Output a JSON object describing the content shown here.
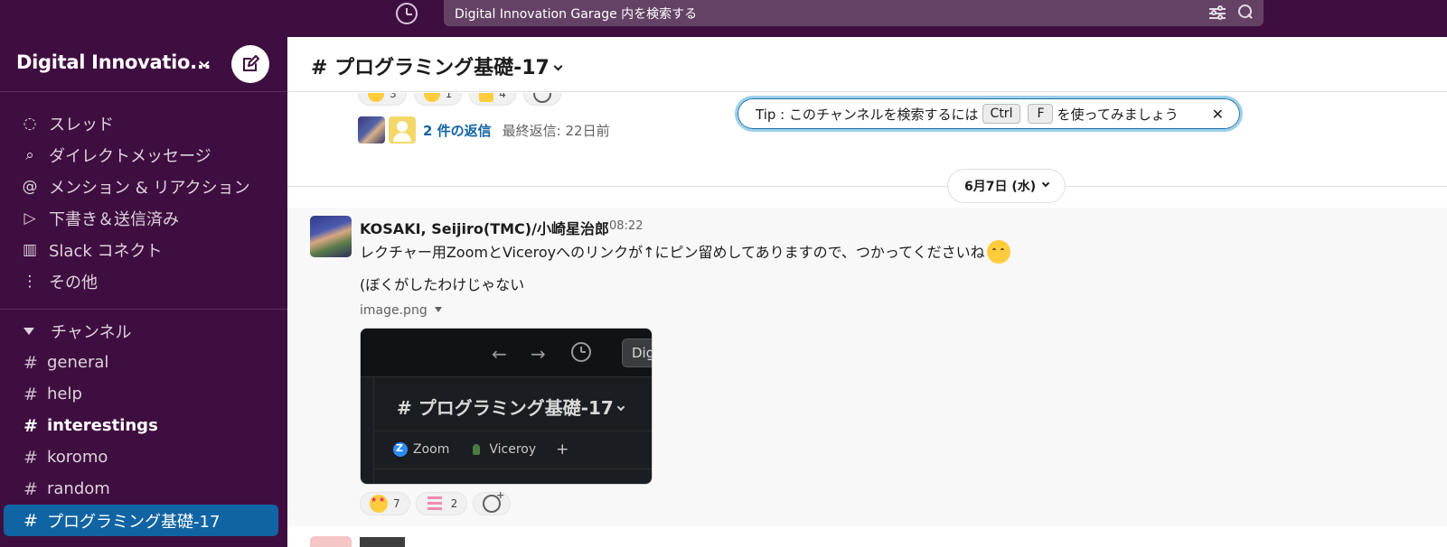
{
  "topbar": {
    "search_placeholder": "Digital Innovation Garage 内を検索する"
  },
  "workspace": {
    "name": "Digital Innovatio..."
  },
  "nav": [
    {
      "label": "スレッド",
      "icon": "threads-icon"
    },
    {
      "label": "ダイレクトメッセージ",
      "icon": "direct-messages-icon"
    },
    {
      "label": "メンション & リアクション",
      "icon": "mentions-icon"
    },
    {
      "label": "下書き＆送信済み",
      "icon": "drafts-icon"
    },
    {
      "label": "Slack コネクト",
      "icon": "slack-connect-icon"
    },
    {
      "label": "その他",
      "icon": "more-icon"
    }
  ],
  "channels_section": {
    "label": "チャンネル",
    "items": [
      {
        "name": "general",
        "bold": false,
        "active": false
      },
      {
        "name": "help",
        "bold": false,
        "active": false
      },
      {
        "name": "interestings",
        "bold": true,
        "active": false
      },
      {
        "name": "koromo",
        "bold": false,
        "active": false
      },
      {
        "name": "random",
        "bold": false,
        "active": false
      },
      {
        "name": "プログラミング基礎-17",
        "bold": false,
        "active": true
      }
    ]
  },
  "channel_header": {
    "title": "# プログラミング基礎-17"
  },
  "previous_message": {
    "reactions": [
      {
        "emoji": "grinning-face",
        "count": "3"
      },
      {
        "emoji": "hugging-face",
        "count": "1"
      },
      {
        "emoji": "thumbs-up",
        "count": "4"
      }
    ],
    "thread": {
      "reply_count": "2 件の返信",
      "last_reply": "最終返信: 22日前"
    }
  },
  "tip": {
    "prefix": "Tip : このチャンネルを検索するには",
    "key1": "Ctrl",
    "key2": "F",
    "suffix": "を使ってみましょう",
    "close": "✕"
  },
  "date_divider": {
    "label": "6月7日 (水)"
  },
  "message": {
    "author": "KOSAKI, Seijiro(TMC)/小崎星治郎",
    "time": "08:22",
    "text": "レクチャー用ZoomとViceroyへのリンクが↑にピン留めしてありますので、つかってくださいね",
    "text2": "(ぼくがしたわけじゃない",
    "file_name": "image.png",
    "image": {
      "search_text": "Dig",
      "channel_title": "# プログラミング基礎-17",
      "bookmarks": [
        "Zoom",
        "Viceroy"
      ],
      "add": "+"
    },
    "reactions": [
      {
        "emoji": "star-struck",
        "count": "7"
      },
      {
        "emoji": "arigatou-stamp",
        "count": "2"
      }
    ]
  },
  "colors": {
    "sidebar_bg": "#3f0e40",
    "active_channel": "#1164a3",
    "link": "#1264a3"
  }
}
